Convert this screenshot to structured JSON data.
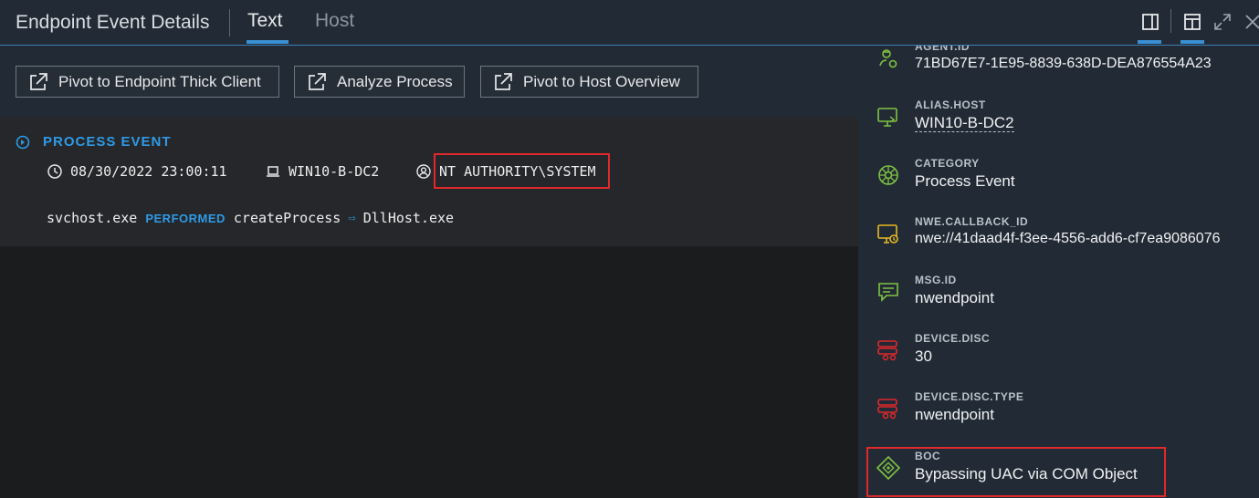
{
  "header": {
    "title": "Endpoint Event Details",
    "tabs": [
      {
        "label": "Text",
        "active": true
      },
      {
        "label": "Host",
        "active": false
      }
    ],
    "icons": [
      "panel-right-icon",
      "layout-icon",
      "expand-icon",
      "close-icon"
    ]
  },
  "toolbar": {
    "buttons": [
      {
        "label": "Pivot to Endpoint Thick Client",
        "icon": "external-link-icon"
      },
      {
        "label": "Analyze Process",
        "icon": "external-link-icon"
      },
      {
        "label": "Pivot to Host Overview",
        "icon": "external-link-icon"
      }
    ]
  },
  "event": {
    "title": "PROCESS EVENT",
    "timestamp": "08/30/2022 23:00:11",
    "host": "WIN10-B-DC2",
    "user": "NT AUTHORITY\\SYSTEM",
    "source": "svchost.exe",
    "performed": "PERFORMED",
    "action": "createProcess",
    "target": "DllHost.exe"
  },
  "fields": [
    {
      "label": "AGENT.ID",
      "value": "71BD67E7-1E95-8839-638D-DEA876554A23",
      "icon": "agent-icon",
      "color": "#7fc241"
    },
    {
      "label": "ALIAS.HOST",
      "value": "WIN10-B-DC2",
      "icon": "host-monitor-icon",
      "color": "#7fc241"
    },
    {
      "label": "CATEGORY",
      "value": "Process Event",
      "icon": "category-wheel-icon",
      "color": "#7fc241"
    },
    {
      "label": "NWE.CALLBACK_ID",
      "value": "nwe://41daad4f-f3ee-4556-add6-cf7ea9086076",
      "icon": "callback-icon",
      "color": "#e8b823"
    },
    {
      "label": "MSG.ID",
      "value": "nwendpoint",
      "icon": "message-icon",
      "color": "#7fc241"
    },
    {
      "label": "DEVICE.DISC",
      "value": "30",
      "icon": "device-disc-icon",
      "color": "#e0282d"
    },
    {
      "label": "DEVICE.DISC.TYPE",
      "value": "nwendpoint",
      "icon": "device-disc-type-icon",
      "color": "#e0282d"
    },
    {
      "label": "BOC",
      "value": "Bypassing UAC via COM Object",
      "icon": "boc-diamond-icon",
      "color": "#7fc241"
    }
  ]
}
